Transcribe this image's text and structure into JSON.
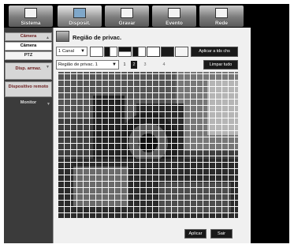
{
  "tabs": [
    {
      "label": "Sistema",
      "icon": "monitor-icon"
    },
    {
      "label": "Disposit.",
      "icon": "device-icon"
    },
    {
      "label": "Gravar",
      "icon": "recording-icon"
    },
    {
      "label": "Evento",
      "icon": "event-icon"
    },
    {
      "label": "Rede",
      "icon": "network-icon"
    }
  ],
  "active_tab": "Disposit.",
  "sidebar": {
    "items": [
      {
        "label": "Câmera",
        "type": "group"
      },
      {
        "label": "Câmera",
        "type": "sub",
        "selected": true
      },
      {
        "label": "PTZ",
        "type": "sub"
      },
      {
        "label": "Disp. armaz.",
        "type": "group"
      },
      {
        "label": "Dispositivo remoto",
        "type": "group"
      },
      {
        "label": "Monitor",
        "type": "group-dark"
      }
    ]
  },
  "page": {
    "title": "Região de privac.",
    "channel_select": "1 Canal",
    "region_select": "Região de privac. 1",
    "apply_all_label": "Aplicar a tds chs",
    "clear_all_label": "Limpar tudo",
    "region_numbers": [
      "1",
      "2",
      "3",
      "4"
    ],
    "selected_region": "2",
    "apply_label": "Aplicar",
    "exit_label": "Sair"
  },
  "colors": {
    "background": "#000000",
    "panel": "#f0f0f0",
    "button": "#1a1a1a",
    "sidebar_accent": "#6a1b1b"
  }
}
